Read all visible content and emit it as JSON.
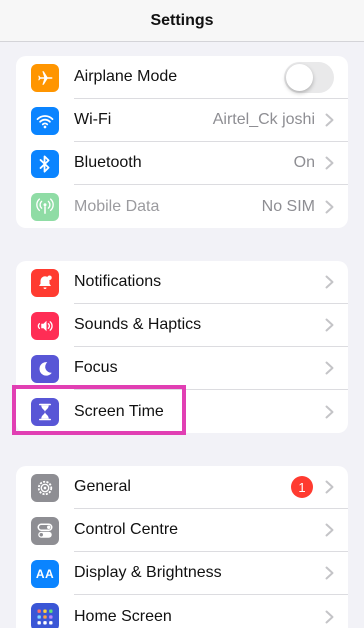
{
  "header": {
    "title": "Settings"
  },
  "groups": [
    {
      "items": [
        {
          "label": "Airplane Mode",
          "icon": "airplane-icon",
          "color": "#ff9500",
          "toggle_on": false
        },
        {
          "label": "Wi-Fi",
          "value": "Airtel_Ck joshi",
          "icon": "wifi-icon",
          "color": "#0a84ff"
        },
        {
          "label": "Bluetooth",
          "value": "On",
          "icon": "bluetooth-icon",
          "color": "#0a84ff"
        },
        {
          "label": "Mobile Data",
          "value": "No SIM",
          "icon": "antenna-icon",
          "color": "#8fdca5",
          "disabled": true
        }
      ]
    },
    {
      "items": [
        {
          "label": "Notifications",
          "icon": "bell-icon",
          "color": "#ff3b30"
        },
        {
          "label": "Sounds & Haptics",
          "icon": "speaker-icon",
          "color": "#ff2d55"
        },
        {
          "label": "Focus",
          "icon": "moon-icon",
          "color": "#5856d6"
        },
        {
          "label": "Screen Time",
          "icon": "hourglass-icon",
          "color": "#5856d6",
          "highlighted": true
        }
      ]
    },
    {
      "items": [
        {
          "label": "General",
          "badge": "1",
          "icon": "gear-icon",
          "color": "#8e8e93"
        },
        {
          "label": "Control Centre",
          "icon": "toggles-icon",
          "color": "#8e8e93"
        },
        {
          "label": "Display & Brightness",
          "icon": "text-size-icon",
          "color": "#0a84ff",
          "icon_text": "AA"
        },
        {
          "label": "Home Screen",
          "icon": "app-grid-icon",
          "color": "#3a56d6"
        }
      ]
    }
  ],
  "highlight_color": "#e13fb3"
}
